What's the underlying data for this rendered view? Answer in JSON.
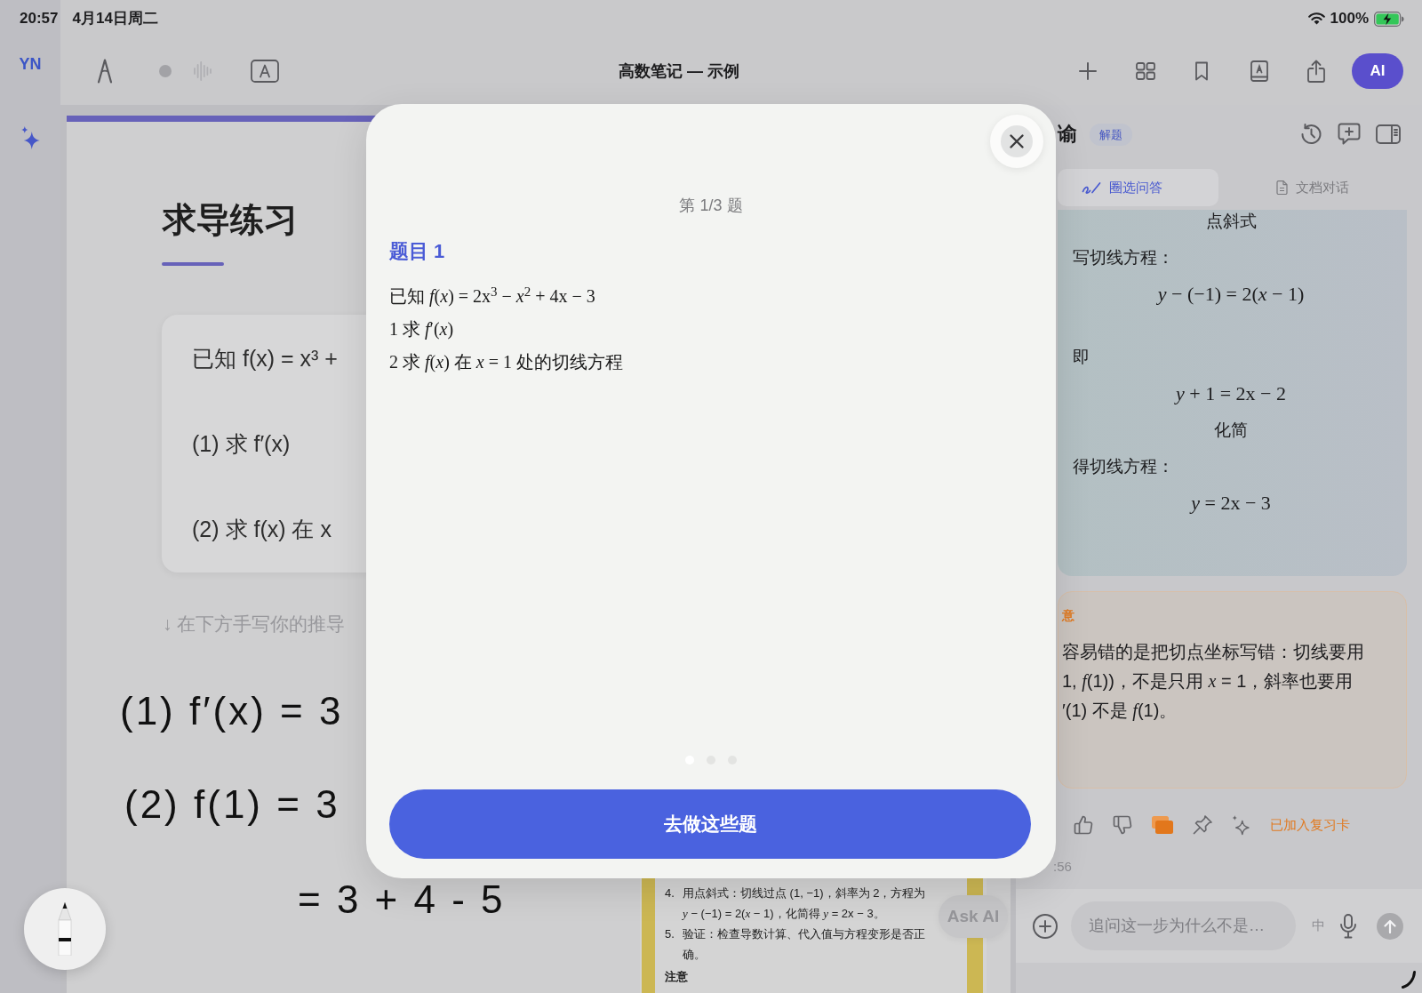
{
  "status_bar": {
    "time": "20:57",
    "date": "4月14日周二",
    "battery": "100%"
  },
  "sidebar": {
    "logo": "YN"
  },
  "toolbar": {
    "title": "高数笔记 — 示例",
    "ai_button": "AI"
  },
  "page": {
    "heading": "求导练习",
    "card_lines": [
      "已知 f(x) = x³ +",
      "(1) 求 f′(x)",
      "(2) 求 f(x) 在 x"
    ],
    "hint": "↓ 在下方手写你的推导",
    "handwriting": [
      "(1) f′(x) = 3",
      "(2) f(1) = 3",
      "= 3 + 4 - 5"
    ],
    "clip": {
      "items": [
        {
          "number": "4.",
          "text": "用点斜式：切线过点 (1, −1)，斜率为 2，方程为\n*y* − (−1) = 2(*x* − 1)，化简得 *y* = 2x − 3。"
        },
        {
          "number": "5.",
          "text": "验证：检查导数计算、代入值与方程变形是否正确。"
        }
      ],
      "heading": "注意"
    },
    "ask_ai": "Ask AI"
  },
  "assistant": {
    "title": "谕",
    "badge": "解题",
    "tabs": [
      {
        "label": "圈选问答",
        "selected": true
      },
      {
        "label": "文档对话",
        "selected": false
      }
    ],
    "answer": [
      {
        "kind": "label",
        "text": "点斜式"
      },
      {
        "kind": "text",
        "text": "写切线方程："
      },
      {
        "kind": "math",
        "text": "*y* − (−1) = 2(*x* − 1)"
      },
      {
        "kind": "text",
        "text": "即"
      },
      {
        "kind": "math",
        "text": "*y* + 1 = 2x − 2"
      },
      {
        "kind": "label",
        "text": "化简"
      },
      {
        "kind": "text",
        "text": "得切线方程："
      },
      {
        "kind": "math",
        "text": "*y* = 2x − 3"
      }
    ],
    "note": {
      "title": "意",
      "text": "容易错的是把切点坐标写错：切线要用\n1, *f*(1))，不是只用 *x* = 1，斜率也要用\n′(1) 不是 *f*(1)。"
    },
    "review_card": {
      "added": true,
      "label": "已加入复习卡"
    },
    "timestamp": ":56",
    "input": {
      "placeholder": "追问这一步为什么不是…",
      "ime": "中"
    }
  },
  "modal": {
    "counter": "第 1/3 题",
    "title": "题目 1",
    "lines": [
      "已知 *f*(*x*) = 2x$^{3}$ − *x*$^{2}$ + 4x − 3",
      "1 求 *f*′(*x*)",
      "2 求 *f*(*x*) 在 *x* = 1 处的切线方程"
    ],
    "pages": [
      {
        "selected": true
      },
      {
        "selected": false
      },
      {
        "selected": false
      }
    ],
    "button": "去做这些题"
  }
}
